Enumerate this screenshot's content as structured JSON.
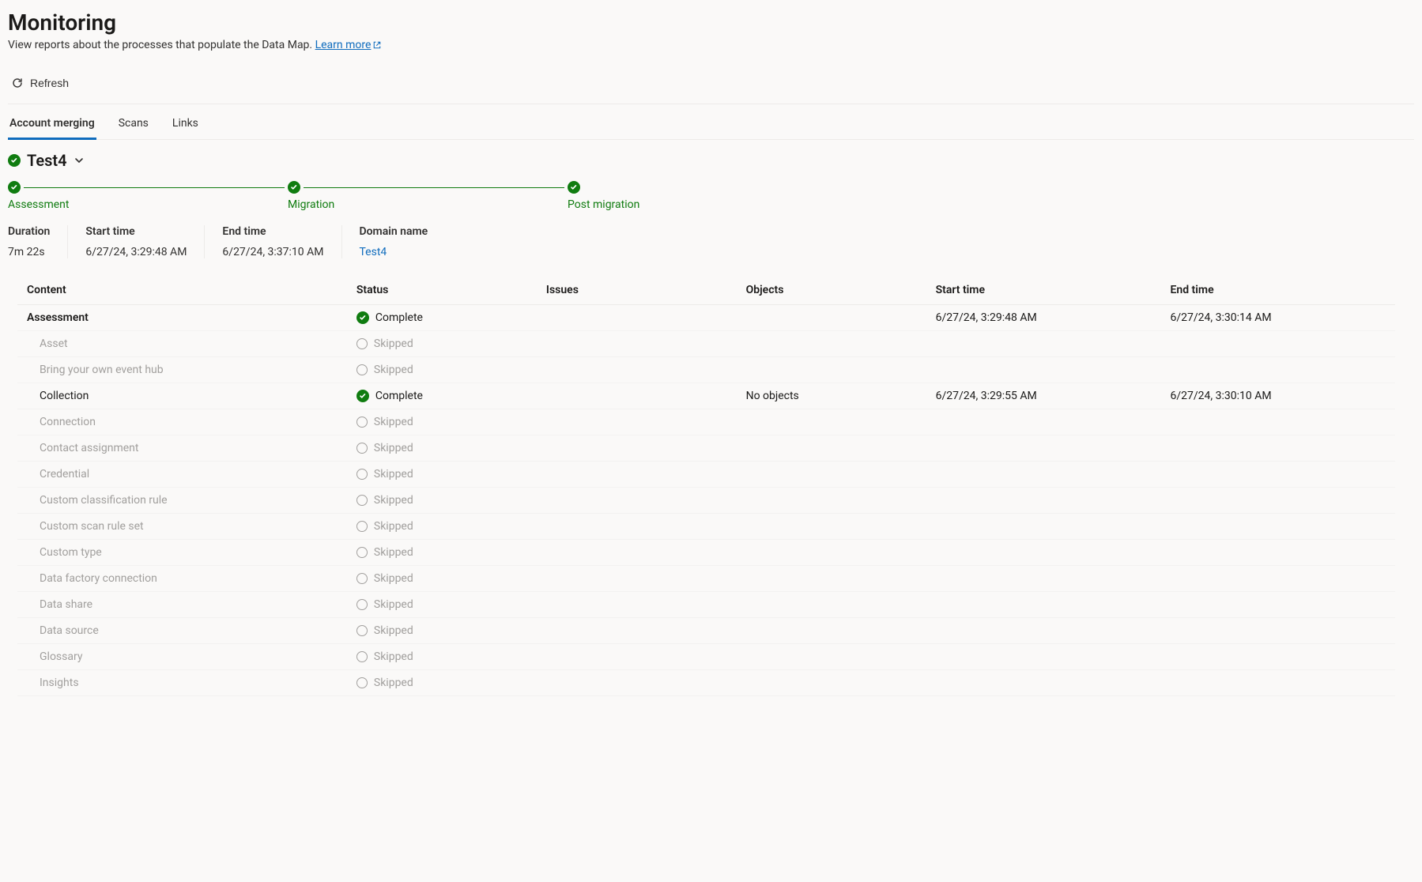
{
  "header": {
    "title": "Monitoring",
    "subtitle_pre": "View reports about the processes that populate the Data Map. ",
    "learn_more": "Learn more"
  },
  "toolbar": {
    "refresh_label": "Refresh"
  },
  "tabs": [
    {
      "label": "Account merging",
      "active": true
    },
    {
      "label": "Scans",
      "active": false
    },
    {
      "label": "Links",
      "active": false
    }
  ],
  "section": {
    "name": "Test4"
  },
  "progress_steps": [
    {
      "label": "Assessment"
    },
    {
      "label": "Migration"
    },
    {
      "label": "Post migration"
    }
  ],
  "summary": {
    "duration_label": "Duration",
    "duration_value": "7m 22s",
    "start_label": "Start time",
    "start_value": "6/27/24, 3:29:48 AM",
    "end_label": "End time",
    "end_value": "6/27/24, 3:37:10 AM",
    "domain_label": "Domain name",
    "domain_value": "Test4"
  },
  "table": {
    "columns": {
      "content": "Content",
      "status": "Status",
      "issues": "Issues",
      "objects": "Objects",
      "start": "Start time",
      "end": "End time"
    },
    "status_labels": {
      "complete": "Complete",
      "skipped": "Skipped"
    },
    "rows": [
      {
        "content": "Assessment",
        "status": "complete",
        "issues": "",
        "objects": "",
        "start": "6/27/24, 3:29:48 AM",
        "end": "6/27/24, 3:30:14 AM",
        "indent": false,
        "bold": true
      },
      {
        "content": "Asset",
        "status": "skipped",
        "issues": "",
        "objects": "",
        "start": "",
        "end": "",
        "indent": true,
        "bold": false
      },
      {
        "content": "Bring your own event hub",
        "status": "skipped",
        "issues": "",
        "objects": "",
        "start": "",
        "end": "",
        "indent": true,
        "bold": false
      },
      {
        "content": "Collection",
        "status": "complete",
        "issues": "",
        "objects": "No objects",
        "start": "6/27/24, 3:29:55 AM",
        "end": "6/27/24, 3:30:10 AM",
        "indent": true,
        "bold": false
      },
      {
        "content": "Connection",
        "status": "skipped",
        "issues": "",
        "objects": "",
        "start": "",
        "end": "",
        "indent": true,
        "bold": false
      },
      {
        "content": "Contact assignment",
        "status": "skipped",
        "issues": "",
        "objects": "",
        "start": "",
        "end": "",
        "indent": true,
        "bold": false
      },
      {
        "content": "Credential",
        "status": "skipped",
        "issues": "",
        "objects": "",
        "start": "",
        "end": "",
        "indent": true,
        "bold": false
      },
      {
        "content": "Custom classification rule",
        "status": "skipped",
        "issues": "",
        "objects": "",
        "start": "",
        "end": "",
        "indent": true,
        "bold": false
      },
      {
        "content": "Custom scan rule set",
        "status": "skipped",
        "issues": "",
        "objects": "",
        "start": "",
        "end": "",
        "indent": true,
        "bold": false
      },
      {
        "content": "Custom type",
        "status": "skipped",
        "issues": "",
        "objects": "",
        "start": "",
        "end": "",
        "indent": true,
        "bold": false
      },
      {
        "content": "Data factory connection",
        "status": "skipped",
        "issues": "",
        "objects": "",
        "start": "",
        "end": "",
        "indent": true,
        "bold": false
      },
      {
        "content": "Data share",
        "status": "skipped",
        "issues": "",
        "objects": "",
        "start": "",
        "end": "",
        "indent": true,
        "bold": false
      },
      {
        "content": "Data source",
        "status": "skipped",
        "issues": "",
        "objects": "",
        "start": "",
        "end": "",
        "indent": true,
        "bold": false
      },
      {
        "content": "Glossary",
        "status": "skipped",
        "issues": "",
        "objects": "",
        "start": "",
        "end": "",
        "indent": true,
        "bold": false
      },
      {
        "content": "Insights",
        "status": "skipped",
        "issues": "",
        "objects": "",
        "start": "",
        "end": "",
        "indent": true,
        "bold": false
      }
    ]
  }
}
